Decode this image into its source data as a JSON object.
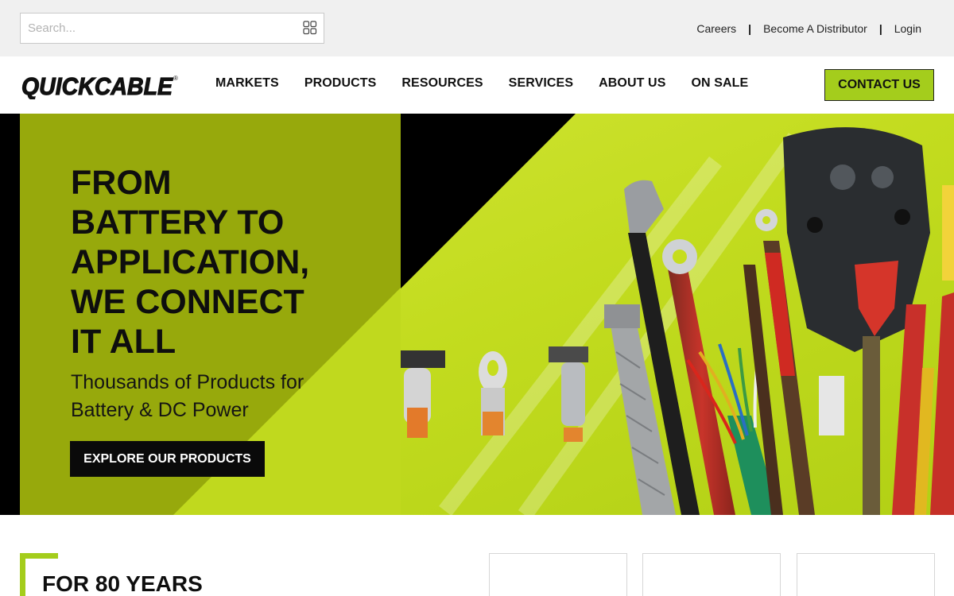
{
  "search": {
    "placeholder": "Search...",
    "value": ""
  },
  "utility_links": [
    "Careers",
    "Become A Distributor",
    "Login"
  ],
  "utility_separator": "|",
  "brand": {
    "name": "QUICKCABLE",
    "registered": "®"
  },
  "nav": [
    "MARKETS",
    "PRODUCTS",
    "RESOURCES",
    "SERVICES",
    "ABOUT US",
    "ON SALE"
  ],
  "contact_label": "CONTACT US",
  "hero": {
    "title_lines": [
      "FROM",
      "BATTERY TO",
      "APPLICATION,",
      "WE CONNECT",
      "IT ALL"
    ],
    "subtitle_lines": [
      "Thousands of Products for",
      "Battery & DC Power"
    ],
    "cta_label": "EXPLORE OUR PRODUCTS"
  },
  "section_heading": "FOR 80 YEARS",
  "colors": {
    "accent": "#a4cd1c",
    "hero_dark_green": "#97a90c",
    "hero_lime": "#c6dd1e",
    "black": "#0a0a0a",
    "topbar": "#f0f0f0"
  },
  "icons": {
    "search": "grid-search-icon"
  }
}
